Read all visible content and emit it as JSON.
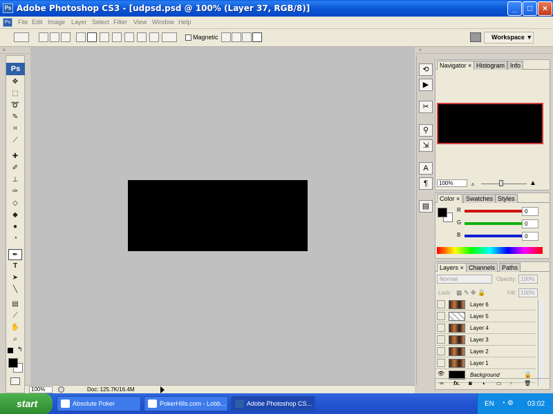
{
  "window": {
    "title": "Adobe Photoshop CS3 - [udpsd.psd @ 100% (Layer 37, RGB/8)]",
    "app_icon": "Ps",
    "minimize": "_",
    "maximize": "□",
    "close": "×"
  },
  "menu": [
    "File",
    "Edit",
    "Image",
    "Layer",
    "Select",
    "Filter",
    "View",
    "Window",
    "Help"
  ],
  "options_bar": {
    "magnetic_label": "Magnetic",
    "workspace_label": "Workspace ▼"
  },
  "toolbox": {
    "logo": "Ps",
    "tools": [
      "move",
      "marquee",
      "lasso",
      "quick-selection",
      "crop",
      "slice",
      "healing",
      "brush",
      "clone-stamp",
      "history-brush",
      "eraser",
      "paint-bucket",
      "blur",
      "dodge",
      "pen",
      "type",
      "path-selection",
      "line",
      "notes",
      "eyedropper",
      "hand",
      "zoom"
    ]
  },
  "status": {
    "zoom": "100%",
    "doc": "Doc: 125.7K/16.4M"
  },
  "navigator": {
    "tabs": [
      "Navigator",
      "Histogram",
      "Info"
    ],
    "zoom": "100%"
  },
  "color_panel": {
    "tabs": [
      "Color",
      "Swatches",
      "Styles"
    ],
    "channels": [
      {
        "label": "R",
        "value": "0",
        "color": "#d01010"
      },
      {
        "label": "G",
        "value": "0",
        "color": "#10b010"
      },
      {
        "label": "B",
        "value": "0",
        "color": "#1020d0"
      }
    ]
  },
  "layers_panel": {
    "tabs": [
      "Layers",
      "Channels",
      "Paths"
    ],
    "blend_mode": "Normal",
    "opacity_label": "Opacity:",
    "opacity": "100%",
    "lock_label": "Lock:",
    "fill_label": "Fill:",
    "fill": "100%",
    "layers": [
      "Layer 6",
      "Layer 5",
      "Layer 4",
      "Layer 3",
      "Layer 2",
      "Layer 1",
      "Background"
    ],
    "footer_fx": "fx."
  },
  "taskbar": {
    "start": "start",
    "tasks": [
      "Absolute Poker",
      "PokerHills.com - Lobb...",
      "Adobe Photoshop CS..."
    ],
    "lang": "EN",
    "clock": "03:02"
  }
}
